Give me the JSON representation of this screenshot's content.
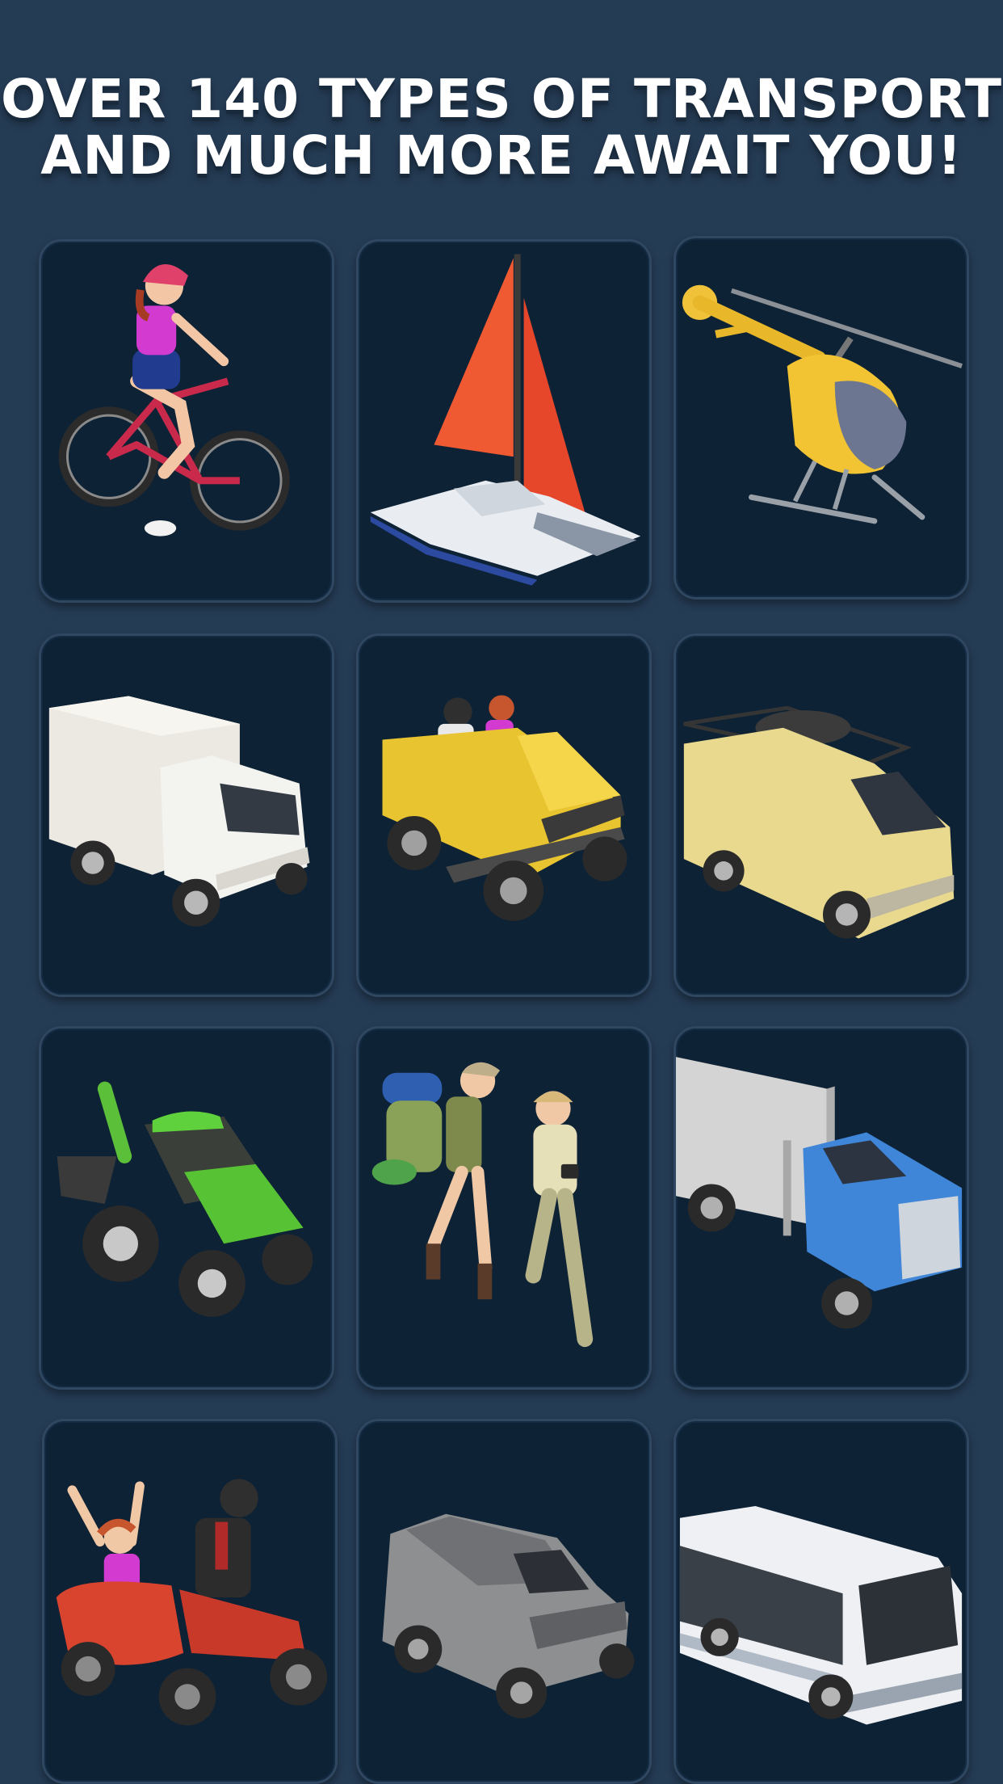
{
  "headline": {
    "line1": "OVER 140 TYPES OF TRANSPORT",
    "line2": "AND MUCH MORE AWAIT YOU!"
  },
  "colors": {
    "background": "#253c55",
    "card": "#0e2235",
    "card_border": "#2f4760",
    "headline_text": "#ffffff"
  },
  "transports": [
    {
      "icon": "bicycle-rider-icon"
    },
    {
      "icon": "catamaran-sailboat-icon"
    },
    {
      "icon": "helicopter-icon"
    },
    {
      "icon": "box-truck-icon"
    },
    {
      "icon": "jeep-offroad-icon"
    },
    {
      "icon": "camper-van-icon"
    },
    {
      "icon": "tractor-backhoe-icon"
    },
    {
      "icon": "hikers-walking-icon"
    },
    {
      "icon": "semi-truck-icon"
    },
    {
      "icon": "motorcycle-sidecar-icon"
    },
    {
      "icon": "suv-car-icon"
    },
    {
      "icon": "city-bus-icon"
    }
  ]
}
